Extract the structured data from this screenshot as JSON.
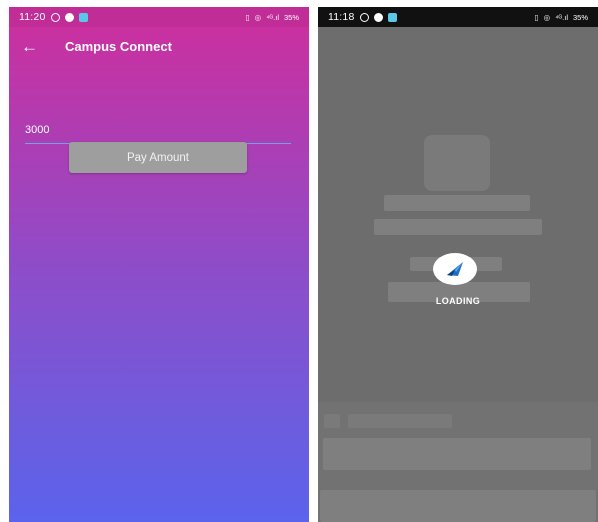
{
  "left_screen": {
    "status_bar": {
      "time": "11:20",
      "battery": "35%",
      "signal_text": "⁴ᴳ.ıl"
    },
    "app_bar": {
      "back_icon": "arrow-left-icon",
      "title": "Campus Connect"
    },
    "amount_input": {
      "value": "3000"
    },
    "pay_button": {
      "label": "Pay Amount"
    },
    "colors": {
      "gradient_top": "#cf2e9c",
      "gradient_bottom": "#5b63ec",
      "button": "#9e9e9e",
      "underline": "#6fa3e8"
    }
  },
  "right_screen": {
    "status_bar": {
      "time": "11:18",
      "battery": "35%",
      "signal_text": "⁴ᴳ.ıl"
    },
    "loader": {
      "icon": "paper-plane-logo-icon",
      "label": "LOADING"
    },
    "colors": {
      "overlay": "#6d6d6d",
      "logo": "#1d6fc4"
    }
  }
}
